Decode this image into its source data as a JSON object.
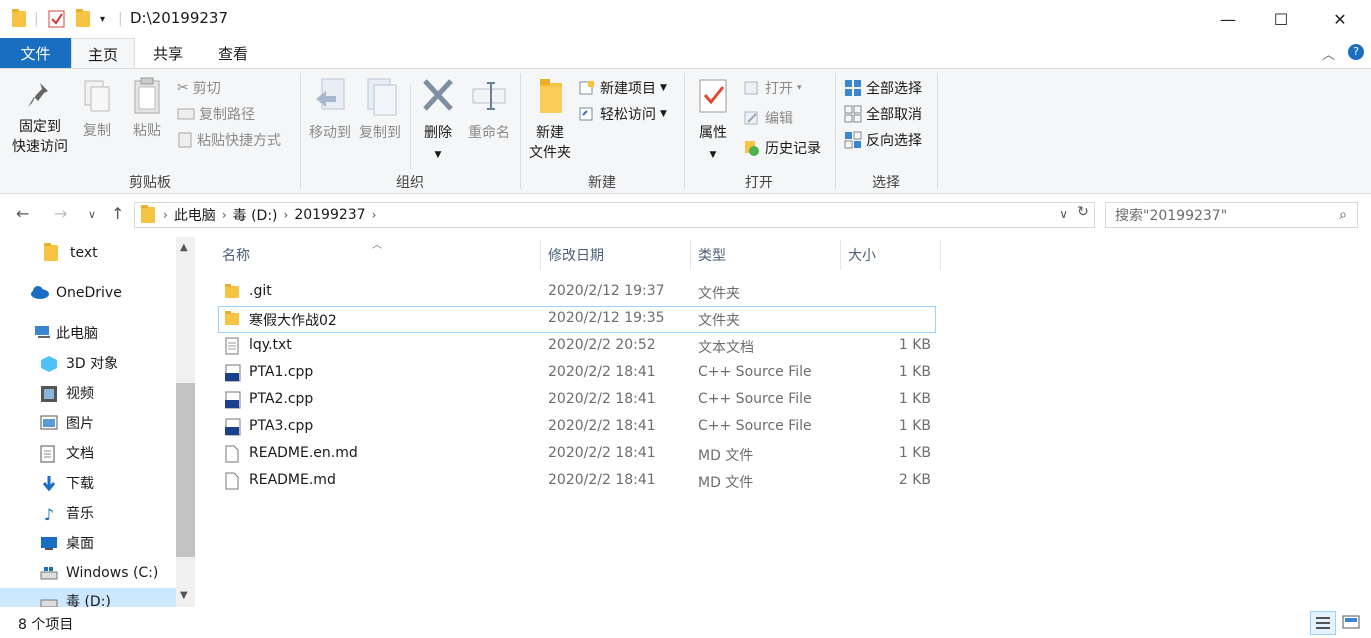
{
  "title_bar": {
    "path": "D:\\20199237",
    "minimize_icon": "—",
    "maximize_icon": "☐",
    "close_icon": "✕"
  },
  "tabs": {
    "file": "文件",
    "home": "主页",
    "share": "共享",
    "view": "查看"
  },
  "ribbon": {
    "clipboard": {
      "pin_line1": "固定到",
      "pin_line2": "快速访问",
      "copy": "复制",
      "paste": "粘贴",
      "cut": "剪切",
      "copy_path": "复制路径",
      "paste_shortcut": "粘贴快捷方式",
      "label": "剪贴板"
    },
    "organize": {
      "move_to": "移动到",
      "copy_to": "复制到",
      "delete": "删除",
      "rename": "重命名",
      "label": "组织"
    },
    "new": {
      "new_folder_line1": "新建",
      "new_folder_line2": "文件夹",
      "new_item": "新建项目",
      "easy_access": "轻松访问",
      "label": "新建"
    },
    "open": {
      "properties": "属性",
      "open": "打开",
      "edit": "编辑",
      "history": "历史记录",
      "label": "打开"
    },
    "select": {
      "select_all": "全部选择",
      "select_none": "全部取消",
      "invert": "反向选择",
      "label": "选择"
    }
  },
  "address": {
    "crumbs": [
      "此电脑",
      "毒 (D:)",
      "20199237"
    ],
    "search_placeholder": "搜索\"20199237\""
  },
  "nav": {
    "items": [
      {
        "label": "text",
        "icon": "folder-icon"
      },
      {
        "label": "OneDrive",
        "icon": "cloud-icon"
      },
      {
        "label": "此电脑",
        "icon": "computer-icon"
      },
      {
        "label": "3D 对象",
        "icon": "cube-icon"
      },
      {
        "label": "视频",
        "icon": "video-icon"
      },
      {
        "label": "图片",
        "icon": "picture-icon"
      },
      {
        "label": "文档",
        "icon": "document-icon"
      },
      {
        "label": "下载",
        "icon": "download-icon"
      },
      {
        "label": "音乐",
        "icon": "music-icon"
      },
      {
        "label": "桌面",
        "icon": "desktop-icon"
      },
      {
        "label": "Windows (C:)",
        "icon": "drive-icon"
      },
      {
        "label": "毒 (D:)",
        "icon": "drive-icon"
      }
    ]
  },
  "columns": {
    "name": "名称",
    "modified": "修改日期",
    "type": "类型",
    "size": "大小"
  },
  "files": [
    {
      "name": ".git",
      "modified": "2020/2/12 19:37",
      "type": "文件夹",
      "size": "",
      "icon": "folder-icon"
    },
    {
      "name": "寒假大作战02",
      "modified": "2020/2/12 19:35",
      "type": "文件夹",
      "size": "",
      "icon": "folder-icon"
    },
    {
      "name": "lqy.txt",
      "modified": "2020/2/2 20:52",
      "type": "文本文档",
      "size": "1 KB",
      "icon": "text-file-icon"
    },
    {
      "name": "PTA1.cpp",
      "modified": "2020/2/2 18:41",
      "type": "C++ Source File",
      "size": "1 KB",
      "icon": "cpp-file-icon"
    },
    {
      "name": "PTA2.cpp",
      "modified": "2020/2/2 18:41",
      "type": "C++ Source File",
      "size": "1 KB",
      "icon": "cpp-file-icon"
    },
    {
      "name": "PTA3.cpp",
      "modified": "2020/2/2 18:41",
      "type": "C++ Source File",
      "size": "1 KB",
      "icon": "cpp-file-icon"
    },
    {
      "name": "README.en.md",
      "modified": "2020/2/2 18:41",
      "type": "MD 文件",
      "size": "1 KB",
      "icon": "md-file-icon"
    },
    {
      "name": "README.md",
      "modified": "2020/2/2 18:41",
      "type": "MD 文件",
      "size": "2 KB",
      "icon": "md-file-icon"
    }
  ],
  "status": {
    "count": "8 个项目"
  },
  "colors": {
    "accent": "#1a6ec2",
    "folder": "#f6c342",
    "hover_border": "#99d1ff"
  }
}
